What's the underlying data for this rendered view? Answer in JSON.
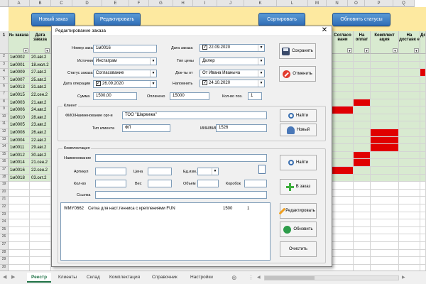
{
  "columns": [
    "A",
    "B",
    "C",
    "D",
    "E",
    "F",
    "G",
    "H",
    "I",
    "J",
    "K",
    "L",
    "M",
    "N",
    "O",
    "P",
    "Q"
  ],
  "toolbar": {
    "new_order": "Новый заказ",
    "edit": "Редактировать",
    "sort": "Сортировать",
    "refresh_statuses": "Обновить статусы"
  },
  "sheet": {
    "header_order_no": "№ заказа",
    "header_order_date": "Дата заказа",
    "right_headers": [
      "Согласо вани",
      "На оплат",
      "Комплект ация",
      "На доставк е",
      "До"
    ],
    "row_numbers": [
      "2",
      "3",
      "4",
      "5",
      "6",
      "7",
      "8",
      "9",
      "10",
      "11",
      "12",
      "13",
      "14",
      "15",
      "16",
      "17",
      "18",
      "19",
      "20",
      "21",
      "22",
      "23",
      "24",
      "25",
      "26",
      "27",
      "28",
      "29",
      "30",
      "31",
      "32",
      "33",
      "34",
      "35",
      "36",
      "37",
      "38",
      "39"
    ],
    "rows": [
      {
        "id": "1м0002",
        "date": "20.авг.2"
      },
      {
        "id": "1м0001",
        "date": "18.июл.2"
      },
      {
        "id": "1м0009",
        "date": "27.авг.2"
      },
      {
        "id": "1м0007",
        "date": "25.авг.2"
      },
      {
        "id": "1м0013",
        "date": "31.авг.2"
      },
      {
        "id": "1м0015",
        "date": "22.сен.2"
      },
      {
        "id": "1м0003",
        "date": "21.авг.2"
      },
      {
        "id": "1м0006",
        "date": "24.авг.2"
      },
      {
        "id": "1м0010",
        "date": "28.авг.2"
      },
      {
        "id": "1м0005",
        "date": "23.авг.2"
      },
      {
        "id": "1м0008",
        "date": "26.авг.2"
      },
      {
        "id": "1м0004",
        "date": "22.авг.2"
      },
      {
        "id": "1м0011",
        "date": "29.авг.2"
      },
      {
        "id": "1м0012",
        "date": "30.авг.2"
      },
      {
        "id": "1м0014",
        "date": "21.сен.2"
      },
      {
        "id": "1м0016",
        "date": "22.сен.2"
      },
      {
        "id": "1м0018",
        "date": "03.окт.2"
      }
    ]
  },
  "sheet_tabs": [
    "Реестр",
    "Клиенты",
    "Склад",
    "Комплектация",
    "Справочник",
    "Настройки"
  ],
  "add_sheet": "⊕",
  "dialog": {
    "title": "Редактирование заказа",
    "close": "✕",
    "order_no_label": "Номер заказа",
    "order_no": "1м0016",
    "source_label": "Источник",
    "source": "Инстаграм",
    "status_label": "Статус заказа",
    "status": "Согласование",
    "op_date_label": "Дата операции",
    "op_date": "26.09.2020",
    "order_date_label": "Дата заказа",
    "order_date": "22.09.2020",
    "price_type_label": "Тип цены",
    "price_type": "Дилер",
    "doc_from_label": "Док-ты от",
    "doc_from": "От Ивана Иваныча",
    "remind_label": "Напомнить",
    "remind": "24.10.2020",
    "sum_label": "Сумма",
    "sum": "1500,00",
    "paid_label": "Оплачено",
    "paid": "15000",
    "qty_pos_label": "Кол-во поз.",
    "qty_pos": "1",
    "save": "Сохранить",
    "cancel": "Отменить",
    "client_group": "Клиент",
    "client_name_label": "ФИО/Наименование орг-и",
    "client_name": "ТОО \"Шарвижа\"",
    "client_type_label": "Тип клиента",
    "client_type": "ФЛ",
    "inn_label": "ИИН/БИН",
    "inn": "1526",
    "find": "Найти",
    "new_client": "Новый",
    "kit_group": "Комплектация",
    "name_label": "Наименование",
    "article_label": "Артикул",
    "price_label": "Цена",
    "unit_label": "Ед.изм.",
    "qty_label": "Кол-во",
    "weight_label": "Вес",
    "volume_label": "Объем",
    "box_label": "Коробок",
    "link_label": "Ссылка",
    "find2": "Найти",
    "to_order": "В заказ",
    "edit_btn": "Редактировать",
    "update_btn": "Обновить",
    "clear_btn": "Очистить",
    "items": [
      {
        "article": "WMY0662",
        "name": "Сетка для наст.тенниса с креплениями FUN",
        "price": "1500",
        "qty": "1"
      }
    ]
  }
}
